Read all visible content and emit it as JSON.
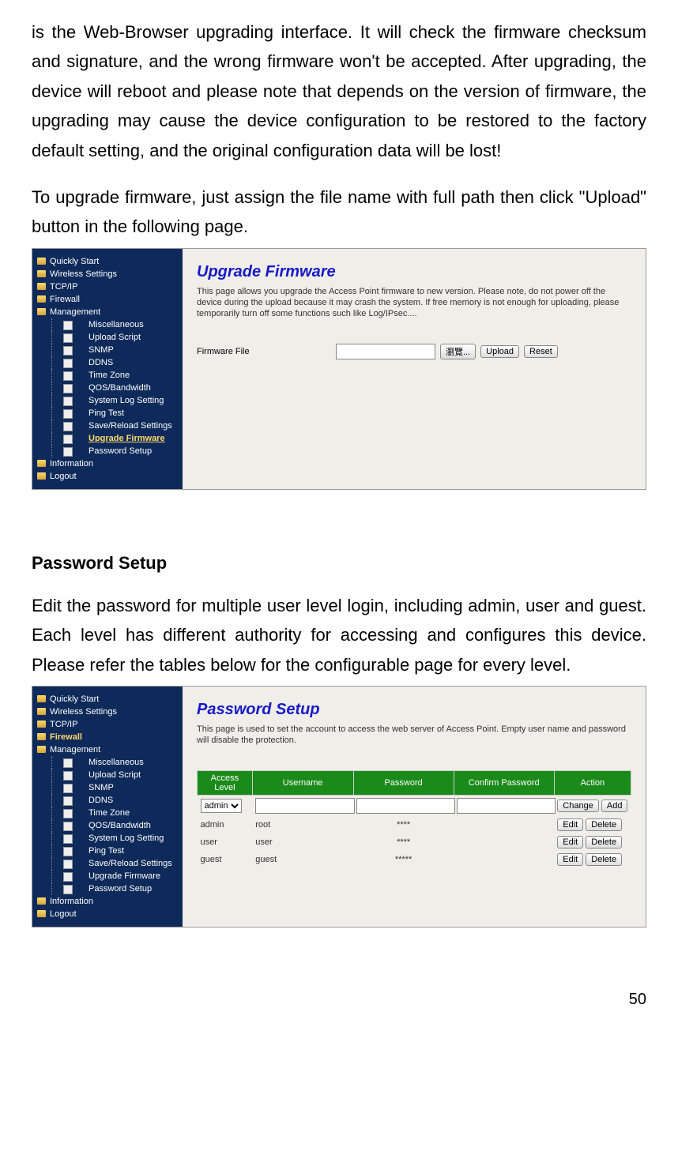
{
  "intro": {
    "p1": "is the Web-Browser upgrading interface. It will check the firmware checksum and signature, and the wrong firmware won't be accepted. After upgrading, the device will reboot and please note that depends on the version of firmware, the upgrading may cause the device configuration to be restored to the factory default setting, and the original configuration data will be lost!",
    "p2": "To upgrade firmware, just assign the file name with full path then click \"Upload\" button in the following page."
  },
  "shot1": {
    "nav_top": [
      "Quickly Start",
      "Wireless Settings",
      "TCP/IP",
      "Firewall",
      "Management"
    ],
    "nav_sub": [
      "Miscellaneous",
      "Upload Script",
      "SNMP",
      "DDNS",
      "Time Zone",
      "QOS/Bandwidth",
      "System Log Setting",
      "Ping Test",
      "Save/Reload Settings",
      "Upgrade Firmware",
      "Password Setup"
    ],
    "nav_bottom": [
      "Information",
      "Logout"
    ],
    "active_sub": "Upgrade Firmware",
    "title": "Upgrade Firmware",
    "desc": "This page allows you upgrade the Access Point firmware to new version. Please note, do not power off the device during the upload because it may crash the system. If free memory is not enough for uploading, please temporarily turn off some functions such like Log/IPsec....",
    "form_label": "Firmware File",
    "browse": "瀏覽...",
    "upload": "Upload",
    "reset": "Reset"
  },
  "section2": {
    "heading": "Password Setup",
    "body": "Edit the password for multiple user level login, including admin, user and guest. Each level has different authority for accessing and configures this device. Please refer the tables below for the configurable page for every level."
  },
  "shot2": {
    "nav_top": [
      "Quickly Start",
      "Wireless Settings",
      "TCP/IP",
      "Firewall",
      "Management"
    ],
    "nav_sub": [
      "Miscellaneous",
      "Upload Script",
      "SNMP",
      "DDNS",
      "Time Zone",
      "QOS/Bandwidth",
      "System Log Setting",
      "Ping Test",
      "Save/Reload Settings",
      "Upgrade Firmware",
      "Password Setup"
    ],
    "nav_bottom": [
      "Information",
      "Logout"
    ],
    "active_top": "Firewall",
    "title": "Password Setup",
    "desc": "This page is used to set the account to access the web server of Access Point. Empty user name and password will disable the protection.",
    "headers": [
      "Access Level",
      "Username",
      "Password",
      "Confirm Password",
      "Action"
    ],
    "row_select": "admin",
    "change": "Change",
    "add": "Add",
    "edit": "Edit",
    "delete": "Delete",
    "rows": [
      {
        "level": "admin",
        "user": "root",
        "pw": "****"
      },
      {
        "level": "user",
        "user": "user",
        "pw": "****"
      },
      {
        "level": "guest",
        "user": "guest",
        "pw": "*****"
      }
    ]
  },
  "page_number": "50"
}
